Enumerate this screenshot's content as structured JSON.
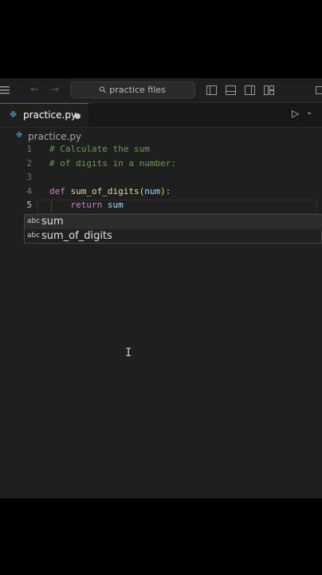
{
  "titlebar": {
    "menu_icon": "menu-icon",
    "back_icon": "arrow-left-icon",
    "forward_icon": "arrow-right-icon",
    "search_placeholder": "practice files"
  },
  "tabs": [
    {
      "label": "practice.py",
      "icon": "python-file-icon",
      "modified": true
    }
  ],
  "breadcrumb": {
    "file": "practice.py"
  },
  "editor": {
    "lines": [
      {
        "num": "1",
        "text": "# Calculate the sum"
      },
      {
        "num": "2",
        "text": "# of digits in a number:"
      },
      {
        "num": "3",
        "text": ""
      },
      {
        "num": "4",
        "keyword": "def",
        "func": "sum_of_digits",
        "lparen": "(",
        "param": "num",
        "rparen": ")",
        "colon": ":"
      },
      {
        "num": "5",
        "indent": "    ",
        "keyword": "return",
        "rest": " sum"
      }
    ],
    "current_line": 5
  },
  "suggestions": [
    {
      "kind": "abc",
      "label": "sum",
      "selected": true
    },
    {
      "kind": "abc",
      "label": "sum_of_digits",
      "selected": false
    }
  ],
  "colors": {
    "background": "#1f1f1f",
    "comment": "#6a9955",
    "keyword": "#c586c0",
    "function": "#dcdcaa",
    "parameter": "#9cdcfe",
    "accent": "#0078d4"
  }
}
